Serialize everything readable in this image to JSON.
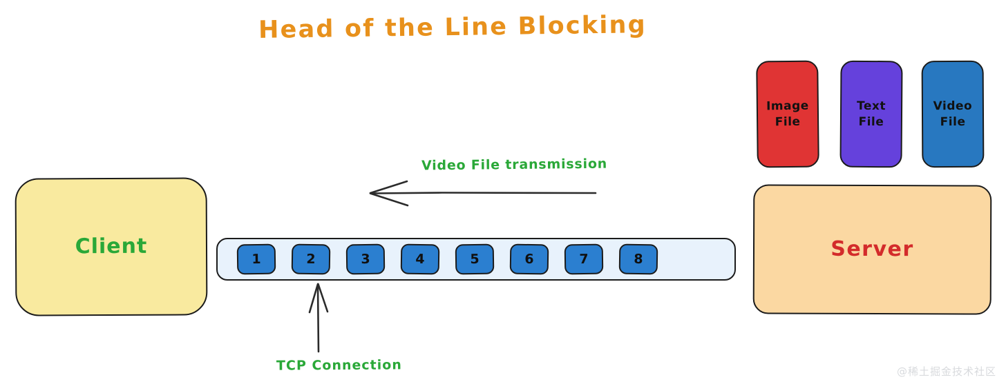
{
  "diagram": {
    "title": "Head of the Line Blocking",
    "title_color": "#e8911c",
    "background": "#ffffff"
  },
  "client": {
    "label": "Client",
    "fill": "#f9ea9f",
    "text_color": "#2aa838"
  },
  "server": {
    "label": "Server",
    "fill": "#fbd8a2",
    "text_color": "#d32b2b"
  },
  "files": [
    {
      "label": "Image\nFile",
      "line1": "Image",
      "line2": "File",
      "fill": "#e03434"
    },
    {
      "label": "Text\nFile",
      "line1": "Text",
      "line2": "File",
      "fill": "#6541dc"
    },
    {
      "label": "Video\nFile",
      "line1": "Video",
      "line2": "File",
      "fill": "#2878c0"
    }
  ],
  "queue": {
    "fill": "#e8f2fc",
    "packet_fill": "#2b7fd0",
    "packets": [
      "1",
      "2",
      "3",
      "4",
      "5",
      "6",
      "7",
      "8"
    ]
  },
  "annotations": {
    "transmission_label": "Video File transmission",
    "transmission_color": "#2aa838",
    "tcp_label": "TCP Connection",
    "tcp_color": "#2aa838"
  },
  "watermark": {
    "text": "@稀土掘金技术社区"
  }
}
